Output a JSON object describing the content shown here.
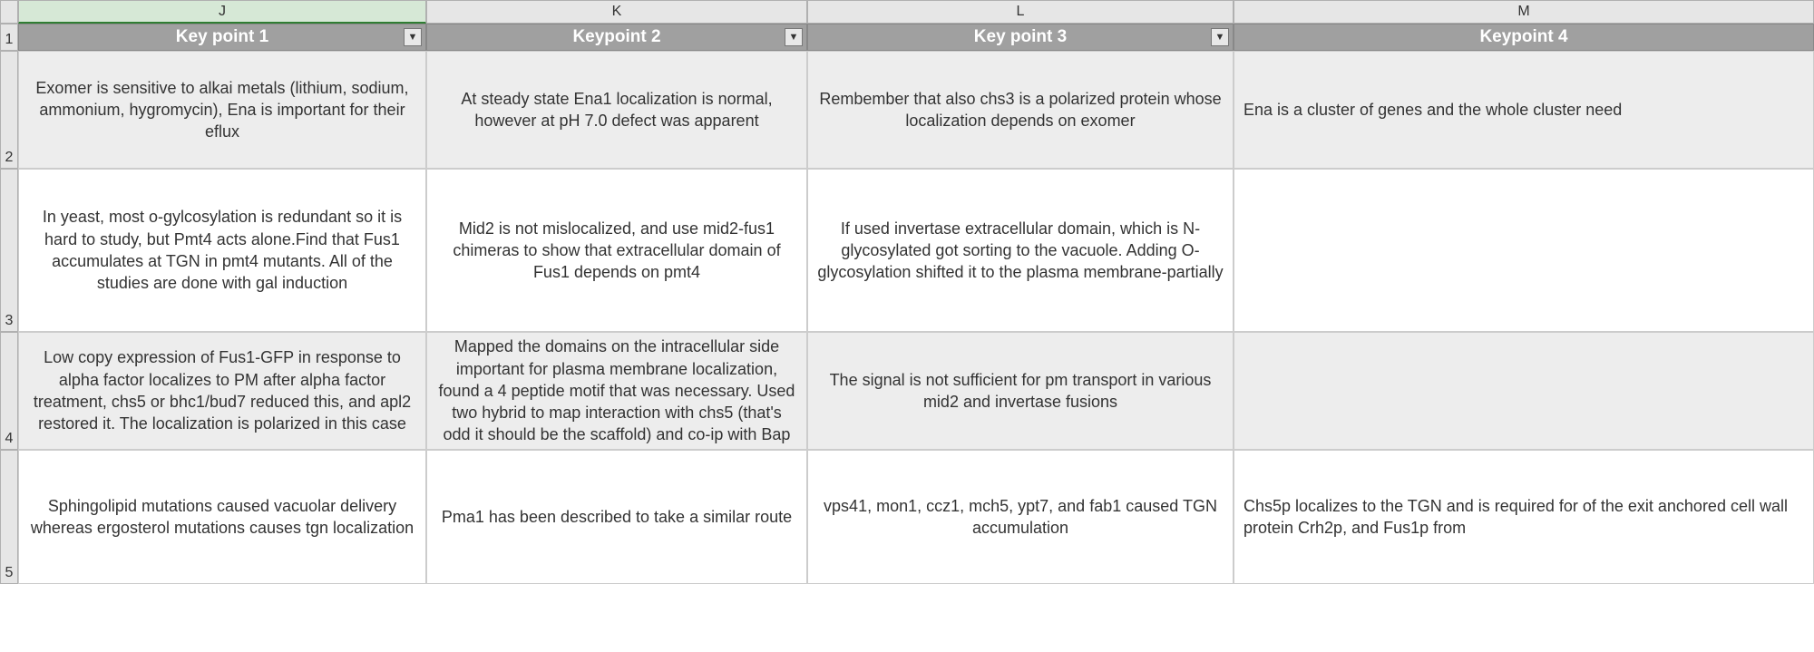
{
  "columns": {
    "letters": [
      "J",
      "K",
      "L",
      "M"
    ],
    "headers": [
      "Key point 1",
      "Keypoint 2",
      "Key point 3",
      "Keypoint 4"
    ],
    "filter_icon": "▼"
  },
  "row_numbers": [
    "1",
    "2",
    "3",
    "4",
    "5"
  ],
  "rows": [
    {
      "alt": true,
      "cells": [
        "Exomer is sensitive to alkai metals (lithium, sodium, ammonium, hygromycin), Ena is important for their eflux",
        "At steady state Ena1 localization is normal, however at pH 7.0 defect was apparent",
        "Rembember that also chs3 is a polarized protein whose localization depends on exomer",
        "Ena is a cluster of genes and the whole cluster need"
      ]
    },
    {
      "alt": false,
      "cells": [
        "In yeast, most o-gylcosylation is redundant so it is hard to study, but Pmt4 acts alone.Find that Fus1 accumulates at TGN in pmt4 mutants. All of the studies are done with gal induction",
        "Mid2 is not mislocalized, and use mid2-fus1 chimeras to show that extracellular domain of Fus1 depends on pmt4",
        "If used invertase extracellular domain, which is N-glycosylated got sorting to the vacuole. Adding O-glycosylation shifted it to the plasma membrane-partially",
        ""
      ]
    },
    {
      "alt": true,
      "cells": [
        "Low copy expression of Fus1-GFP in response to alpha factor localizes to PM after alpha factor treatment, chs5 or bhc1/bud7  reduced this, and apl2 restored it. The localization is polarized in this case",
        "Mapped the domains on the intracellular side important for plasma membrane localization, found a 4 peptide motif that was necessary. Used two hybrid to map interaction with chs5 (that's odd it should be the scaffold) and co-ip with Bap",
        "The signal is not sufficient for pm transport in various mid2 and invertase fusions",
        ""
      ]
    },
    {
      "alt": false,
      "cells": [
        "Sphingolipid mutations caused vacuolar delivery whereas ergosterol mutations causes tgn localization",
        "Pma1 has been described to take a similar route",
        "vps41, mon1, ccz1, mch5, ypt7, and fab1 caused TGN accumulation",
        "Chs5p localizes to the TGN and is required for of the exit anchored cell wall protein Crh2p, and Fus1p from"
      ]
    }
  ]
}
